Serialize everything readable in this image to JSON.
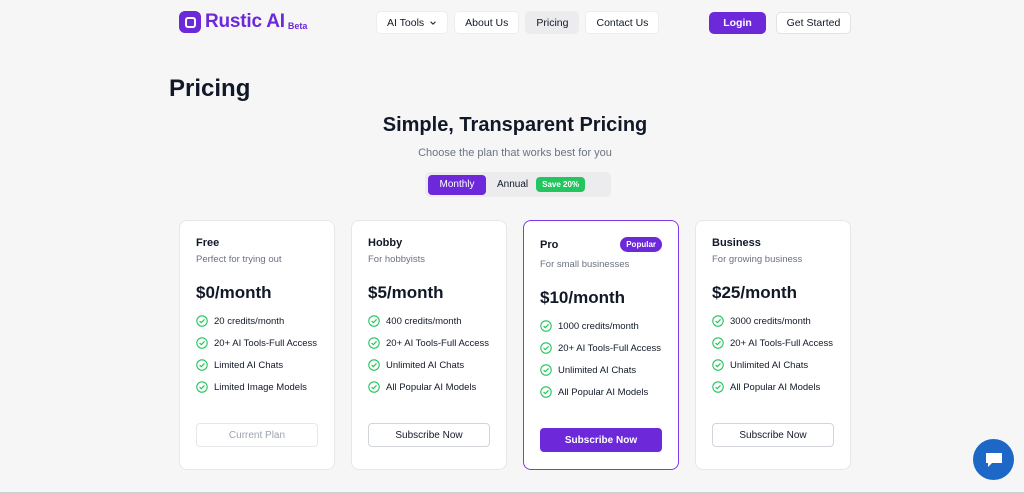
{
  "brand": {
    "name": "Rustic AI",
    "badge": "Beta"
  },
  "nav": {
    "items": [
      {
        "label": "AI Tools"
      },
      {
        "label": "About Us"
      },
      {
        "label": "Pricing"
      },
      {
        "label": "Contact Us"
      }
    ]
  },
  "auth": {
    "login": "Login",
    "get_started": "Get Started"
  },
  "page": {
    "title": "Pricing"
  },
  "section": {
    "title": "Simple, Transparent Pricing",
    "subtitle": "Choose the plan that works best for you"
  },
  "billing_toggle": {
    "monthly": "Monthly",
    "annual": "Annual",
    "save_badge": "Save 20%",
    "selected": "Monthly"
  },
  "plans": [
    {
      "name": "Free",
      "description": "Perfect for trying out",
      "price": "$0/month",
      "features": [
        "20 credits/month",
        "20+ AI Tools-Full Access",
        "Limited AI Chats",
        "Limited Image Models"
      ],
      "button": "Current Plan"
    },
    {
      "name": "Hobby",
      "description": "For hobbyists",
      "price": "$5/month",
      "features": [
        "400 credits/month",
        "20+ AI Tools-Full Access",
        "Unlimited AI Chats",
        "All Popular AI Models"
      ],
      "button": "Subscribe Now"
    },
    {
      "name": "Pro",
      "description": "For small businesses",
      "price": "$10/month",
      "badge": "Popular",
      "features": [
        "1000 credits/month",
        "20+ AI Tools-Full Access",
        "Unlimited AI Chats",
        "All Popular AI Models"
      ],
      "button": "Subscribe Now"
    },
    {
      "name": "Business",
      "description": "For growing business",
      "price": "$25/month",
      "features": [
        "3000 credits/month",
        "20+ AI Tools-Full Access",
        "Unlimited AI Chats",
        "All Popular AI Models"
      ],
      "button": "Subscribe Now"
    }
  ],
  "colors": {
    "accent": "#6d28d9",
    "check": "#22c55e",
    "chat": "#1d67c7"
  },
  "icons": {
    "check": "check-circle-icon",
    "chat": "chat-icon",
    "chevron": "chevron-down-icon"
  }
}
